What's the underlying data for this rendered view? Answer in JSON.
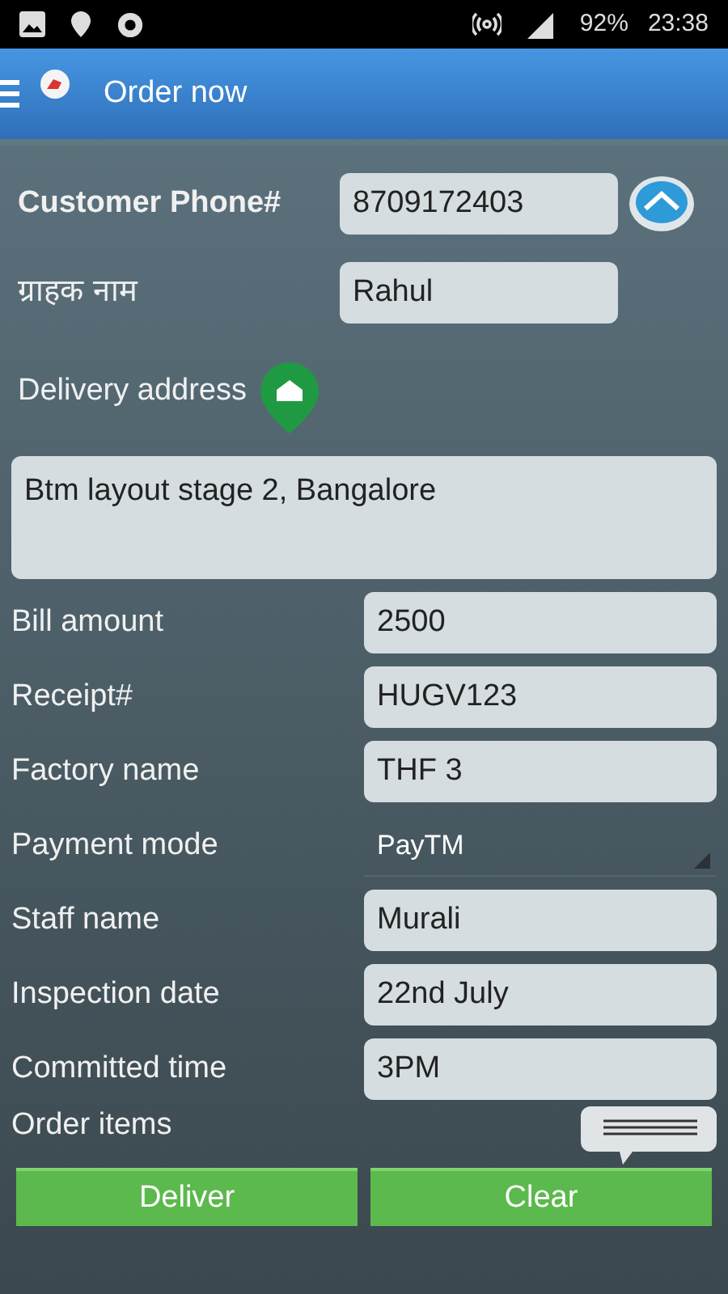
{
  "status_bar": {
    "battery": "92%",
    "time": "23:38"
  },
  "app_bar": {
    "title": "Order now"
  },
  "customer": {
    "phone_label": "Customer Phone#",
    "phone": "8709172403",
    "name_label": "ग्राहक नाम",
    "name": "Rahul"
  },
  "delivery": {
    "label": "Delivery address",
    "address": "Btm layout stage 2, Bangalore"
  },
  "fields": [
    {
      "label": "Bill amount",
      "value": "2500",
      "kind": "text"
    },
    {
      "label": "Receipt#",
      "value": "HUGV123",
      "kind": "text"
    },
    {
      "label": "Factory name",
      "value": "THF 3",
      "kind": "text"
    },
    {
      "label": "Payment mode",
      "value": "PayTM",
      "kind": "dropdown"
    },
    {
      "label": "Staff name",
      "value": "Murali",
      "kind": "text"
    },
    {
      "label": "Inspection date",
      "value": "22nd July",
      "kind": "text"
    },
    {
      "label": "Committed time",
      "value": "3PM",
      "kind": "text"
    }
  ],
  "order_items": {
    "label": "Order items"
  },
  "buttons": [
    "Deliver",
    "Clear"
  ]
}
